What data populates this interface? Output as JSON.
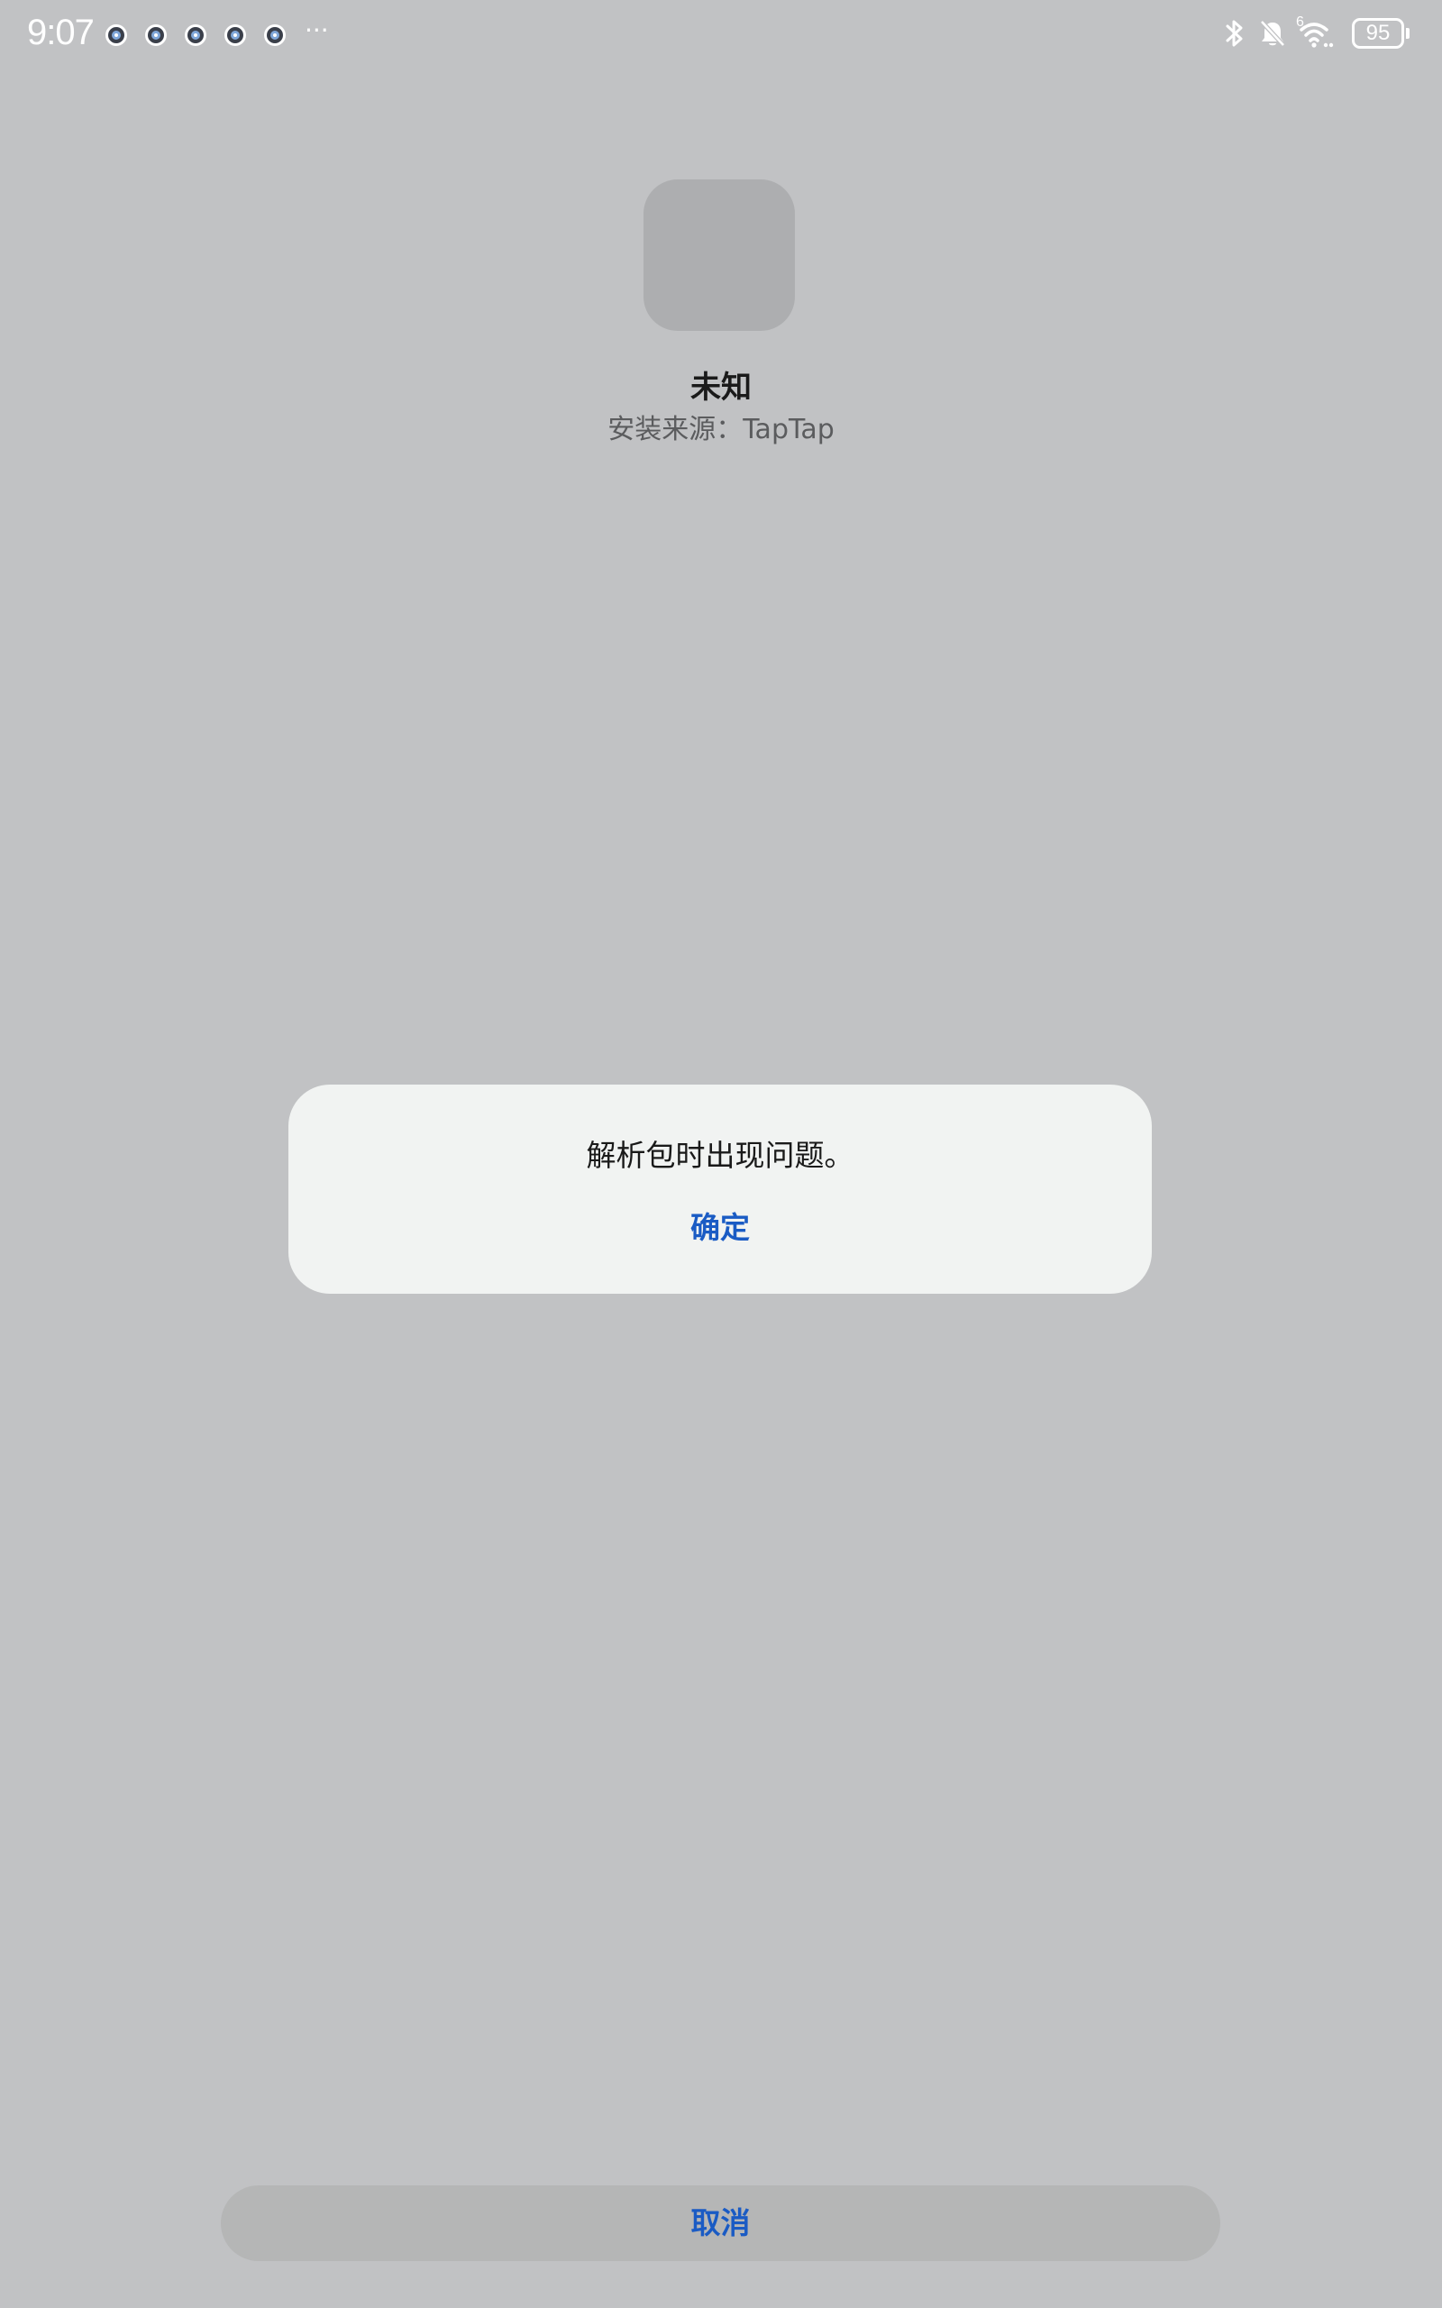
{
  "status_bar": {
    "time": "9:07",
    "notification_icons": [
      "app-notification-icon",
      "app-notification-icon",
      "app-notification-icon",
      "app-notification-icon",
      "app-notification-icon"
    ],
    "more": "···",
    "network_label": "6",
    "battery_level": "95"
  },
  "app": {
    "name": "未知",
    "source": "安装来源：TapTap"
  },
  "dialog": {
    "message": "解析包时出现问题。",
    "confirm_label": "确定"
  },
  "footer": {
    "cancel_label": "取消"
  },
  "colors": {
    "background": "#c1c2c4",
    "dialog_background": "#f1f3f2",
    "accent": "#1a5bc4",
    "icon_placeholder": "#adaeb0",
    "cancel_background": "#b5b6b6"
  }
}
